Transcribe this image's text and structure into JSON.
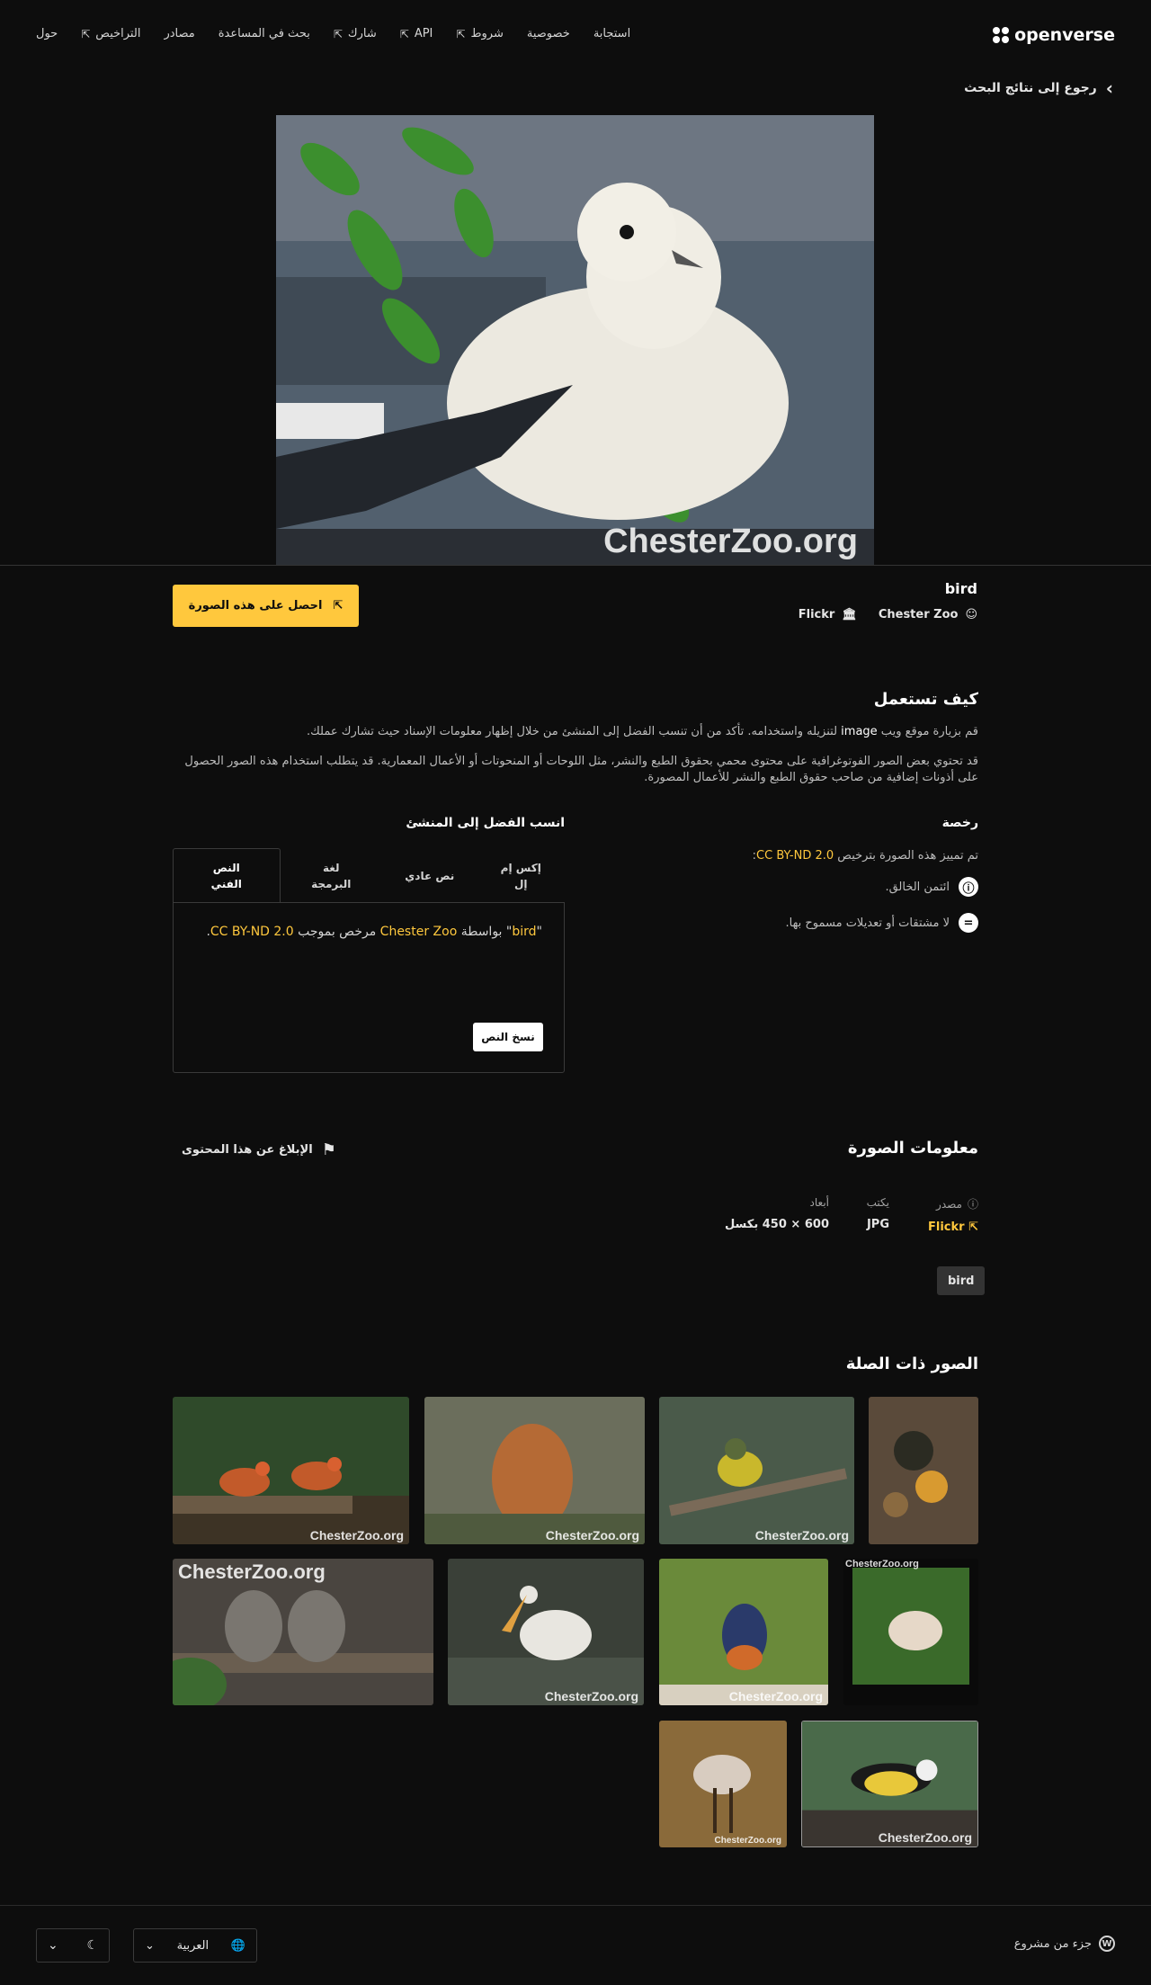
{
  "header": {
    "logo_text": "openverse",
    "nav": [
      {
        "label": "حول",
        "external": false
      },
      {
        "label": "التراخيص",
        "external": true
      },
      {
        "label": "مصادر",
        "external": false
      },
      {
        "label": "بحث في المساعدة",
        "external": false
      },
      {
        "label": "شارك",
        "external": true
      },
      {
        "label": "API",
        "external": true
      },
      {
        "label": "شروط",
        "external": true
      },
      {
        "label": "خصوصية",
        "external": false
      },
      {
        "label": "استجابة",
        "external": false
      }
    ]
  },
  "back_link": "رجوع إلى نتائج البحث",
  "image": {
    "title": "bird",
    "watermark": "ChesterZoo.org",
    "creator": "Chester Zoo",
    "source": "Flickr",
    "get_button": "احصل على هذه الصورة"
  },
  "how_to_use": {
    "title": "كيف تستعمل",
    "p1_before": "قم بزيارة موقع ويب ",
    "p1_media": "image",
    "p1_after": " لتنزيله واستخدامه. تأكد من أن تنسب الفضل إلى المنشئ من خلال إظهار معلومات الإسناد حيث تشارك عملك.",
    "p2": "قد تحتوي بعض الصور الفوتوغرافية على محتوى محمي بحقوق الطبع والنشر، مثل اللوحات أو المنحوتات أو الأعمال المعمارية. قد يتطلب استخدام هذه الصور الحصول على أذونات إضافية من صاحب حقوق الطبع والنشر للأعمال المصورة."
  },
  "license": {
    "title": "رخصة",
    "marked_text": "تم تمييز هذه الصورة بترخيص",
    "license_name": "CC BY-ND 2.0",
    "colon": ":",
    "items": [
      {
        "icon": "by-icon",
        "symbol": "ⓘ",
        "text": "ائتمن الخالق."
      },
      {
        "icon": "nd-icon",
        "symbol": "=",
        "text": "لا مشتقات أو تعديلات مسموح بها."
      }
    ]
  },
  "attribution": {
    "title": "انسب الفضل إلى المنشئ",
    "tabs": [
      "النص الفني",
      "لغة البرمجة",
      "نص عادي",
      "إكس إم إل"
    ],
    "text_quote_open": "\"",
    "text_title": "bird",
    "text_quote_close": "\"",
    "text_by": " بواسطة ",
    "text_creator": "Chester Zoo",
    "text_licensed": " مرخص بموجب ",
    "text_license": "CC BY-ND 2.0",
    "text_period": ".",
    "copy_button": "نسخ النص"
  },
  "image_info": {
    "title": "معلومات الصورة",
    "report": "الإبلاغ عن هذا المحتوى",
    "source_label": "مصدر",
    "source_value": "Flickr",
    "type_label": "يكتب",
    "type_value": "JPG",
    "dims_label": "أبعاد",
    "dims_value": "600 × 450 بكسل",
    "tag": "bird"
  },
  "related": {
    "title": "الصور ذات الصلة",
    "watermarks": [
      "ChesterZoo.org",
      "ChesterZoo.org",
      "ChesterZoo.org",
      "",
      "ChesterZoo.org",
      "ChesterZoo.org",
      "ChesterZoo.org",
      "ChesterZoo.org",
      "ChesterZoo.org",
      "ChesterZoo.org"
    ]
  },
  "footer": {
    "wp_text": "جزء من مشروع",
    "language": "العربية"
  },
  "colors": {
    "background": "#0d0d0d",
    "accent": "#ffc83d"
  }
}
